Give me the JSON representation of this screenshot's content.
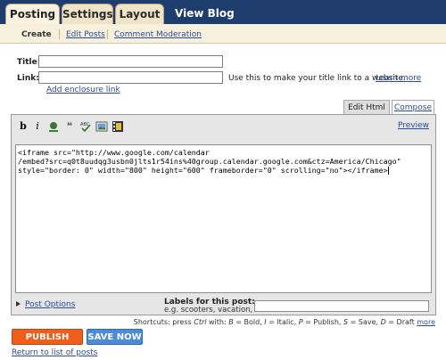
{
  "tabs": {
    "posting": "Posting",
    "settings": "Settings",
    "layout": "Layout",
    "view_blog": "View Blog"
  },
  "subnav": {
    "create": "Create",
    "edit_posts": "Edit Posts",
    "comment_moderation": "Comment Moderation"
  },
  "form": {
    "title_label": "Title:",
    "title_value": "",
    "link_label": "Link:",
    "link_value": "",
    "link_hint": "Use this to make your title link to a website.",
    "learn_more": "Learn more",
    "add_enclosure": "Add enclosure link"
  },
  "editor": {
    "tab_edit_html": "Edit Html",
    "tab_compose": "Compose",
    "preview": "Preview",
    "toolbar_icons": [
      "bold-icon",
      "italic-icon",
      "font-color-icon",
      "blockquote-icon",
      "spellcheck-icon",
      "insert-image-icon",
      "insert-video-icon"
    ],
    "content_lines": [
      "<iframe src=\"http://www.google.com/calendar",
      "/embed?src=q0t8uudqg3usbn0jlts1r54ins%40group.calendar.google.com&ctz=America/Chicago\"",
      "style=\"border: 0\" width=\"800\" height=\"600\" frameborder=\"0\" scrolling=\"no\"></iframe>"
    ],
    "post_options": "Post Options",
    "labels_label": "Labels for this post:",
    "labels_example": "e.g. scooters, vacation, fall",
    "labels_value": ""
  },
  "shortcuts": {
    "prefix": "Shortcuts: press ",
    "ctrl": "Ctrl",
    "with": " with: ",
    "b": "B",
    "bold": " = Bold, ",
    "i": "I",
    "italic": " = Italic, ",
    "p": "P",
    "publish": " = Publish, ",
    "s": "S",
    "save": " = Save, ",
    "d": "D",
    "draft": " = Draft ",
    "more": "more"
  },
  "actions": {
    "publish": "PUBLISH POST",
    "save": "SAVE NOW",
    "return": "Return to list of posts"
  }
}
